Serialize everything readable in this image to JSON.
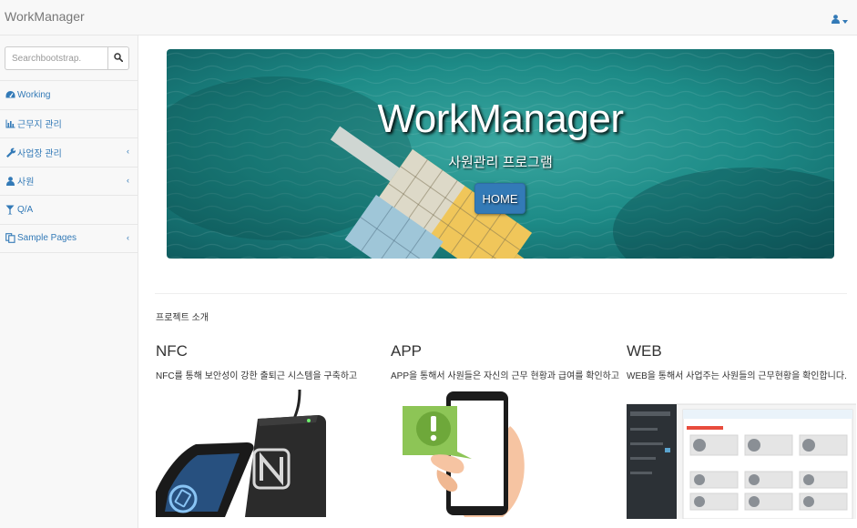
{
  "navbar": {
    "brand": "WorkManager",
    "user_icon": "user-icon",
    "caret_icon": "caret-down-icon"
  },
  "sidebar": {
    "search": {
      "placeholder": "Searchbootstrap.",
      "value": ""
    },
    "items": [
      {
        "label": "Working",
        "icon": "dashboard-icon",
        "has_caret": false
      },
      {
        "label": "근무지 관리",
        "icon": "bar-chart-icon",
        "has_caret": false
      },
      {
        "label": "사업장 관리",
        "icon": "wrench-icon",
        "has_caret": true
      },
      {
        "label": "사원",
        "icon": "user-icon",
        "has_caret": true
      },
      {
        "label": "Q/A",
        "icon": "cocktail-icon",
        "has_caret": false
      },
      {
        "label": "Sample Pages",
        "icon": "files-icon",
        "has_caret": true
      }
    ],
    "caret_glyph": "‹"
  },
  "hero": {
    "title": "WorkManager",
    "subtitle": "사원관리 프로그램",
    "button_label": "HOME"
  },
  "section": {
    "label": "프로젝트 소개",
    "columns": [
      {
        "title": "NFC",
        "description": "NFC를 통해 보안성이 강한 출퇴근 시스템을 구축하고"
      },
      {
        "title": "APP",
        "description": "APP을 통해서 사원들은 자신의 근무 현황과 급여를 확인하고"
      },
      {
        "title": "WEB",
        "description": "WEB을 통해서 사업주는 사원들의 근무현황을 확인합니다."
      }
    ]
  },
  "colors": {
    "link": "#337ab7",
    "navbar_bg": "#f8f8f8",
    "sidebar_bg": "#f8f8f8",
    "button": "#337ab7",
    "sea": "#1a8a88"
  }
}
